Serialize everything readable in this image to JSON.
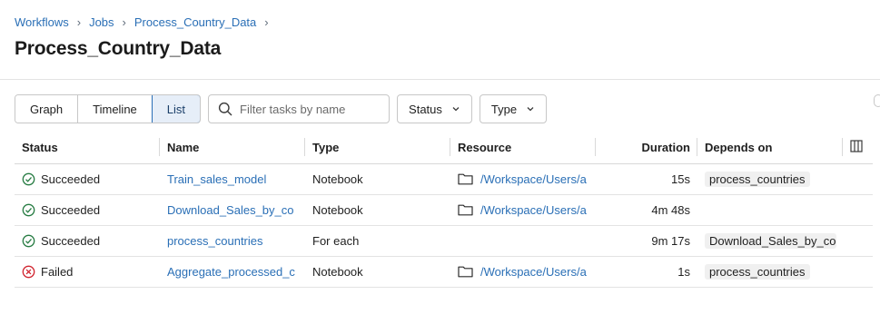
{
  "breadcrumb": [
    "Workflows",
    "Jobs",
    "Process_Country_Data"
  ],
  "breadcrumb_separator": "›",
  "title": "Process_Country_Data",
  "view_tabs": [
    "Graph",
    "Timeline",
    "List"
  ],
  "active_tab": "List",
  "search": {
    "placeholder": "Filter tasks by name",
    "value": ""
  },
  "filters": {
    "status_label": "Status",
    "type_label": "Type"
  },
  "table": {
    "headers": [
      "Status",
      "Name",
      "Type",
      "Resource",
      "Duration",
      "Depends on"
    ],
    "rows": [
      {
        "status": "Succeeded",
        "status_kind": "success",
        "name": "Train_sales_model",
        "type": "Notebook",
        "resource": "/Workspace/Users/a",
        "has_resource": true,
        "duration": "15s",
        "depends_on": "process_countries"
      },
      {
        "status": "Succeeded",
        "status_kind": "success",
        "name": "Download_Sales_by_co",
        "type": "Notebook",
        "resource": "/Workspace/Users/a",
        "has_resource": true,
        "duration": "4m 48s",
        "depends_on": ""
      },
      {
        "status": "Succeeded",
        "status_kind": "success",
        "name": "process_countries",
        "type": "For each",
        "resource": "",
        "has_resource": false,
        "duration": "9m 17s",
        "depends_on": "Download_Sales_by_co"
      },
      {
        "status": "Failed",
        "status_kind": "failed",
        "name": "Aggregate_processed_c",
        "type": "Notebook",
        "resource": "/Workspace/Users/a",
        "has_resource": true,
        "duration": "1s",
        "depends_on": "process_countries"
      }
    ]
  },
  "colors": {
    "link": "#2a6fb6",
    "success": "#277c43",
    "failed": "#d1242f",
    "active_tab_bg": "#e6eef8"
  },
  "icons": {
    "search": "search-icon",
    "chevron": "chevron-down-icon",
    "folder": "folder-icon",
    "columns": "columns-icon",
    "success": "check-circle-icon",
    "failed": "x-circle-icon"
  }
}
